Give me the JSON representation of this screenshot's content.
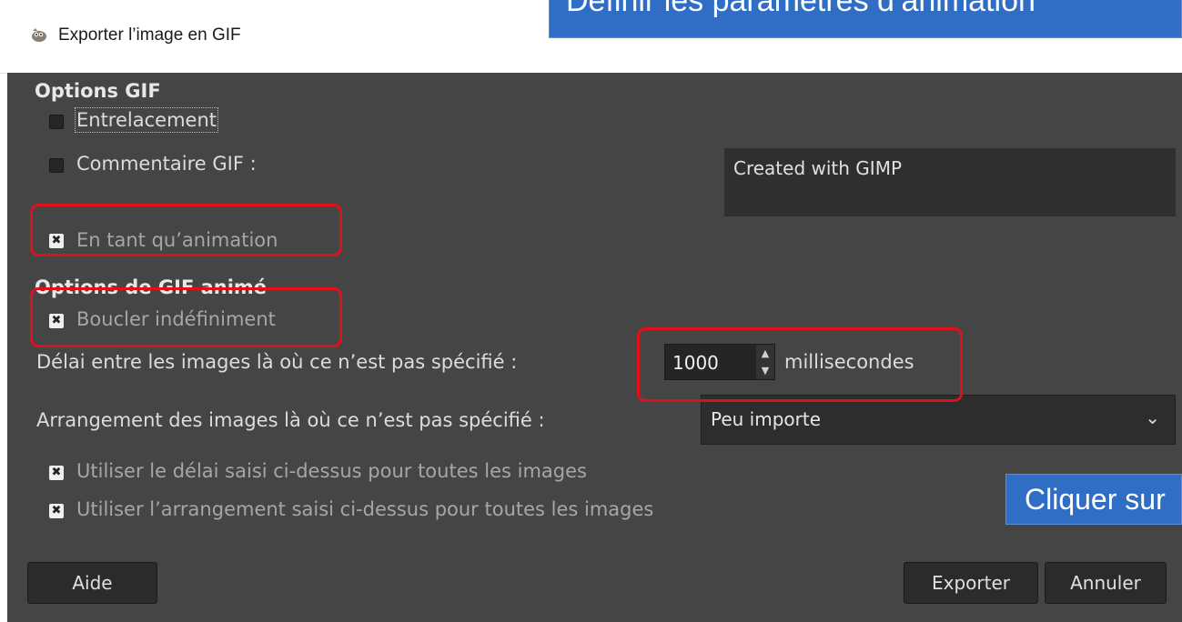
{
  "window": {
    "title": "Exporter l’image en GIF",
    "close_glyph": "✕",
    "icon": "gimp-icon"
  },
  "gif_options": {
    "heading": "Options GIF",
    "interlace_label": "Entrelacement",
    "interlace_checked": false,
    "comment_label": "Commentaire  GIF :",
    "comment_checked": false,
    "comment_value": "Created with GIMP",
    "as_animation_label": "En tant qu’animation",
    "as_animation_checked": true
  },
  "animated_options": {
    "heading": "Options de GIF animé",
    "loop_label": "Boucler indéfiniment",
    "loop_checked": true,
    "delay_label": "Délai entre les images là où ce n’est pas spécifié :",
    "delay_value": "1000",
    "delay_unit": "millisecondes",
    "disposal_label": "Arrangement des images là où ce n’est pas spécifié :",
    "disposal_value": "Peu importe",
    "use_delay_all_label": "Utiliser le délai saisi ci-dessus pour toutes les images",
    "use_delay_all_checked": true,
    "use_disposal_all_label": "Utiliser l’arrangement saisi ci-dessus pour toutes les images",
    "use_disposal_all_checked": true
  },
  "buttons": {
    "help": "Aide",
    "export": "Exporter",
    "cancel": "Annuler"
  },
  "annotations": {
    "callout_top": "Définir les paramètres d’animation",
    "callout_right": "Cliquer sur",
    "highlight_color": "#e0101a",
    "callout_color": "#2f6ec4"
  },
  "checkmark_glyph": "✖"
}
